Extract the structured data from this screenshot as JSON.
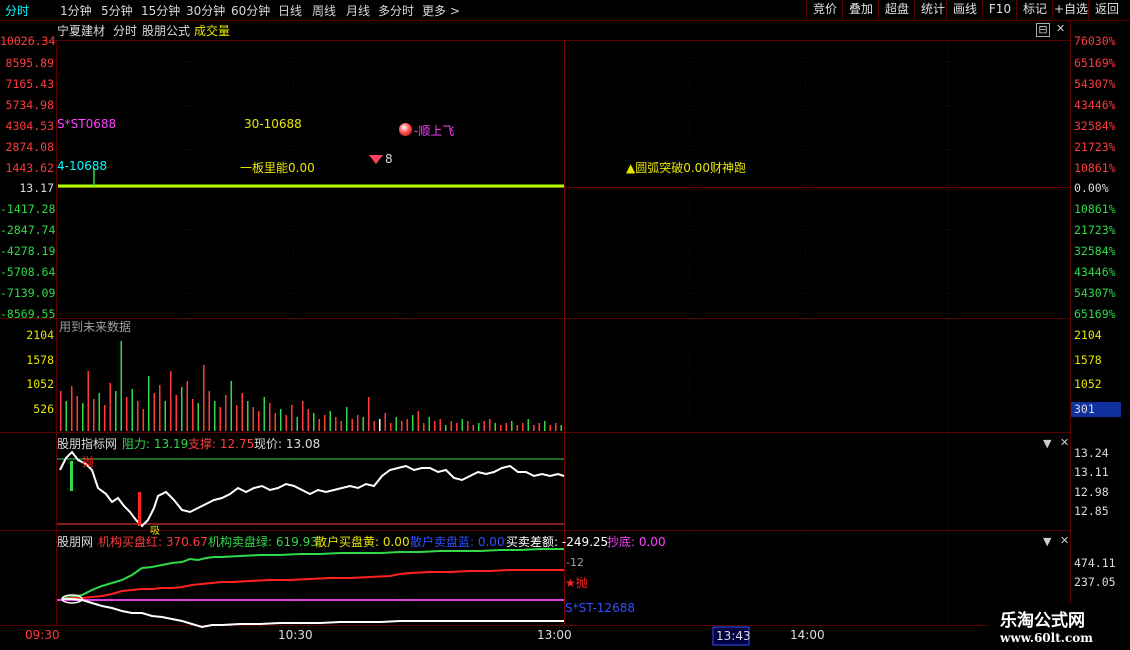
{
  "toolbar": {
    "periods": [
      "分时",
      "1分钟",
      "5分钟",
      "15分钟",
      "30分钟",
      "60分钟",
      "日线",
      "周线",
      "月线",
      "多分时",
      "更多 >"
    ],
    "buttons": [
      "竞价",
      "叠加",
      "超盘",
      "统计",
      "画线",
      "F10",
      "标记",
      "+自选",
      "返回"
    ]
  },
  "header": {
    "stock_name": "宁夏建材",
    "mode": "分时",
    "formula": "股朋公式",
    "indicator": "成交量"
  },
  "price_axis": {
    "left": [
      "10026.34",
      "8595.89",
      "7165.43",
      "5734.98",
      "4304.53",
      "2874.08",
      "1443.62",
      "13.17",
      "-1417.28",
      "-2847.74",
      "-4278.19",
      "-5708.64",
      "-7139.09",
      "-8569.55"
    ],
    "right": [
      "76030%",
      "65169%",
      "54307%",
      "43446%",
      "32584%",
      "21723%",
      "10861%",
      "0.00%",
      "10861%",
      "21723%",
      "32584%",
      "43446%",
      "54307%",
      "65169%"
    ]
  },
  "price_annotations": {
    "st_label": "S*ST0688",
    "mid_label": "30-10688",
    "fly_label": "-顺上飞",
    "left_label": "4-10688",
    "board_label": "一板里能0.00",
    "small_num": "8",
    "arc_label": "▲圆弧突破0.00财神跑"
  },
  "volume": {
    "notice": "用到未来数据",
    "axis": [
      "2104",
      "1578",
      "1052",
      "526"
    ],
    "badge": "301"
  },
  "indicator1": {
    "name": "股朋指标网",
    "resist_label": "阻力: 13.19",
    "support_label": "支撑: 12.75",
    "price_label": "现价: 13.08",
    "axis": [
      "13.24",
      "13.11",
      "12.98",
      "12.85"
    ],
    "throw_label": "抛",
    "buy_label": "吸"
  },
  "indicator2": {
    "name": "股朋网",
    "inst_buy": "机构买盘红: 370.67",
    "inst_sell": "机构卖盘绿: 619.93",
    "retail_buy": "散户买盘黄: 0.00",
    "retail_sell": "散户卖盘蓝: 0.00",
    "diff": "买卖差额: -249.25",
    "bottom": "抄底: 0.00",
    "axis": [
      "474.11",
      "237.05"
    ],
    "minus_label": "-12",
    "throw_label": "★抛",
    "st_label": "S*ST-12688"
  },
  "time_axis": {
    "ticks": [
      "09:30",
      "10:30",
      "13:00",
      "14:00"
    ],
    "cursor": "13:43"
  },
  "watermark": {
    "title": "乐淘公式网",
    "url": "www.60lt.com"
  },
  "icons": {
    "dropdown": "▼",
    "close": "✕",
    "panel_settings": "⊟"
  },
  "colors": {
    "up": "#ff3b3b",
    "down": "#2fd94a",
    "grid": "#5a0000",
    "price_line": "#aaff00"
  }
}
